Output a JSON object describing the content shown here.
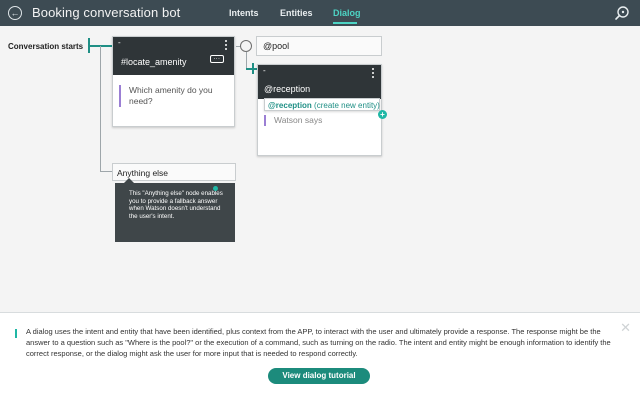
{
  "header": {
    "back_icon": "back-arrow-icon",
    "title": "Booking conversation bot",
    "tabs": [
      {
        "label": "Intents",
        "active": false
      },
      {
        "label": "Entities",
        "active": false
      },
      {
        "label": "Dialog",
        "active": true
      }
    ],
    "helper_icon": "chat-help-icon"
  },
  "canvas": {
    "start_label": "Conversation starts",
    "node1": {
      "dash": "-",
      "condition": "#locate_amenity",
      "more": "...",
      "response": "Which amenity do you need?"
    },
    "pool_field": "@pool",
    "node2": {
      "dash": "-",
      "condition": "@reception",
      "response": "Watson says"
    },
    "suggestion": {
      "entity": "@reception",
      "action": " (create new entity)"
    },
    "anything_else": "Anything else",
    "tooltip": "This \"Anything else\" node enables you to provide a fallback answer when Watson doesn't understand the user's intent."
  },
  "tutorial": {
    "text": "A dialog uses the intent and entity that have been identified, plus context from the APP, to interact with the user and ultimately provide a response. The response might be the answer to a question such as \"Where is the pool?\" or the execution of a command, such as turning on the radio. The intent and entity might be enough information to identify the correct response, or the dialog might ask the user for more input that is needed to respond correctly.",
    "button_label": "View dialog tutorial",
    "close_icon": "close-icon"
  },
  "colors": {
    "header_bg": "#3d4b53",
    "accent": "#4dd4c4",
    "primary_button": "#1c8b7c",
    "node_head": "#2f3538"
  }
}
